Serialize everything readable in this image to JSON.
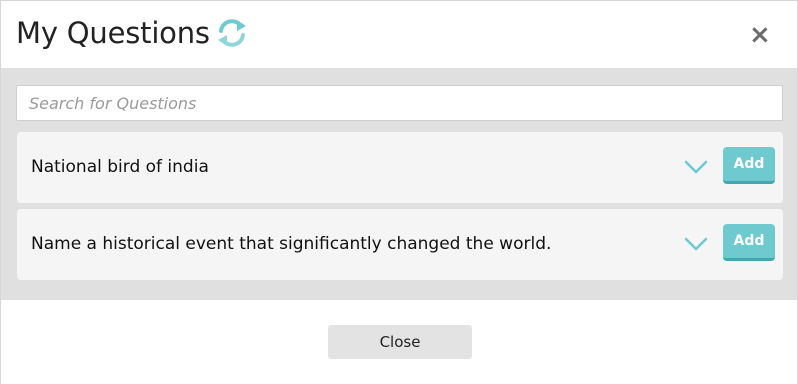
{
  "header": {
    "title": "My Questions",
    "close_symbol": "×",
    "refresh_icon": "refresh-icon",
    "close_icon": "close-icon"
  },
  "search": {
    "placeholder": "Search for Questions",
    "value": ""
  },
  "questions": [
    {
      "text": "National bird of india",
      "add_label": "Add",
      "expand_icon": "chevron-down-icon"
    },
    {
      "text": "Name a historical event that significantly changed the world.",
      "add_label": "Add",
      "expand_icon": "chevron-down-icon"
    }
  ],
  "footer": {
    "close_label": "Close"
  },
  "colors": {
    "accent": "#6fcad0",
    "accent_dark": "#45a7ae",
    "panel_bg": "#e0e0e0",
    "card_bg": "#f5f5f5"
  }
}
